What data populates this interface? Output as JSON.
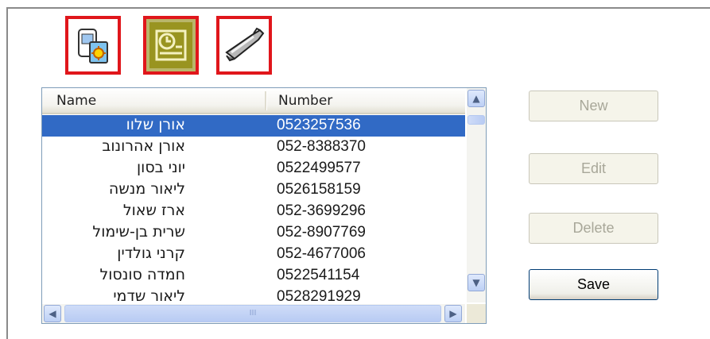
{
  "toolbar": {
    "icons": [
      {
        "name": "phone-sim-icon"
      },
      {
        "name": "calendar-clock-icon"
      },
      {
        "name": "mobile-phone-icon"
      }
    ]
  },
  "list": {
    "columns": [
      "Name",
      "Number"
    ],
    "rows": [
      {
        "name": "אורן שלוו",
        "number": "0523257536",
        "selected": true
      },
      {
        "name": "אורן אהרונוב",
        "number": "052-8388370"
      },
      {
        "name": "יוני בסון",
        "number": "0522499577"
      },
      {
        "name": "ליאור מנשה",
        "number": "0526158159"
      },
      {
        "name": "ארז שאול",
        "number": "052-3699296"
      },
      {
        "name": "שרית בן-שימול",
        "number": "052-8907769"
      },
      {
        "name": "קרני גולדין",
        "number": "052-4677006"
      },
      {
        "name": "חמדה סונסול",
        "number": "0522541154"
      },
      {
        "name": "ליאור שדמי",
        "number": "0528291929"
      }
    ],
    "hscroll_grip": "III"
  },
  "buttons": {
    "new": "New",
    "edit": "Edit",
    "delete": "Delete",
    "save": "Save"
  }
}
